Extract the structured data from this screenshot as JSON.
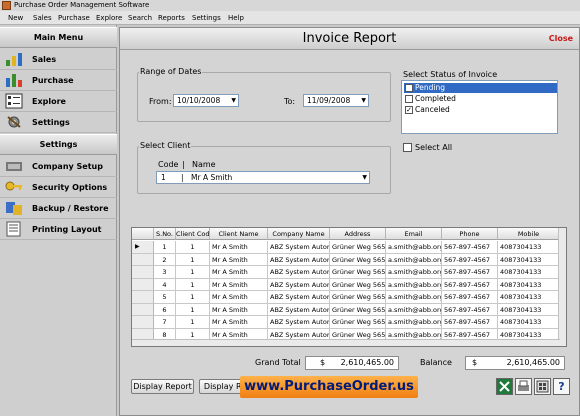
{
  "window": {
    "title": "Purchase Order Management Software"
  },
  "menubar": [
    "New",
    "Sales",
    "Purchase",
    "Explore",
    "Search",
    "Reports",
    "Settings",
    "Help"
  ],
  "sidebar": {
    "main_menu_title": "Main Menu",
    "main_items": [
      {
        "label": "Sales",
        "icon": "sales-chart-icon"
      },
      {
        "label": "Purchase",
        "icon": "purchase-chart-icon"
      },
      {
        "label": "Explore",
        "icon": "explore-list-icon"
      },
      {
        "label": "Settings",
        "icon": "settings-gear-icon"
      }
    ],
    "settings_title": "Settings",
    "settings_items": [
      {
        "label": "Company Setup",
        "icon": "company-setup-icon"
      },
      {
        "label": "Security Options",
        "icon": "security-key-icon"
      },
      {
        "label": "Backup / Restore",
        "icon": "backup-restore-icon"
      },
      {
        "label": "Printing Layout",
        "icon": "printing-layout-icon"
      }
    ]
  },
  "report": {
    "title": "Invoice Report",
    "close_label": "Close",
    "date_range": {
      "group_label": "Range of Dates",
      "from_label": "From:",
      "from_value": "10/10/2008",
      "to_label": "To:",
      "to_value": "11/09/2008"
    },
    "client": {
      "group_label": "Select Client",
      "code_header": "Code",
      "separator": "|",
      "name_header": "Name",
      "selected_code": "1",
      "selected_name": "Mr A Smith"
    },
    "status": {
      "group_label": "Select Status of Invoice",
      "options": [
        {
          "label": "Pending",
          "checked": "✓",
          "selected": true
        },
        {
          "label": "Completed",
          "checked": "",
          "selected": false
        },
        {
          "label": "Canceled",
          "checked": "✓",
          "selected": false
        }
      ],
      "select_all_label": "Select All"
    },
    "table": {
      "columns": [
        "S.No.",
        "Client Code",
        "Client Name",
        "Company Name",
        "Address",
        "Email",
        "Phone",
        "Mobile"
      ],
      "rows": [
        [
          "1",
          "1",
          "Mr A Smith",
          "ABZ System Autom...",
          "Grüner Weg 565...",
          "a.smith@abb.org",
          "567-897-4567",
          "4087304133"
        ],
        [
          "2",
          "1",
          "Mr A Smith",
          "ABZ System Autom...",
          "Grüner Weg 565...",
          "a.smith@abb.org",
          "567-897-4567",
          "4087304133"
        ],
        [
          "3",
          "1",
          "Mr A Smith",
          "ABZ System Autom...",
          "Grüner Weg 565...",
          "a.smith@abb.org",
          "567-897-4567",
          "4087304133"
        ],
        [
          "4",
          "1",
          "Mr A Smith",
          "ABZ System Autom...",
          "Grüner Weg 565...",
          "a.smith@abb.org",
          "567-897-4567",
          "4087304133"
        ],
        [
          "5",
          "1",
          "Mr A Smith",
          "ABZ System Autom...",
          "Grüner Weg 565...",
          "a.smith@abb.org",
          "567-897-4567",
          "4087304133"
        ],
        [
          "6",
          "1",
          "Mr A Smith",
          "ABZ System Autom...",
          "Grüner Weg 565...",
          "a.smith@abb.org",
          "567-897-4567",
          "4087304133"
        ],
        [
          "7",
          "1",
          "Mr A Smith",
          "ABZ System Autom...",
          "Grüner Weg 565...",
          "a.smith@abb.org",
          "567-897-4567",
          "4087304133"
        ],
        [
          "8",
          "1",
          "Mr A Smith",
          "ABZ System Autom...",
          "Grüner Weg 565...",
          "a.smith@abb.org",
          "567-897-4567",
          "4087304133"
        ]
      ],
      "current_row_marker": "▶"
    },
    "totals": {
      "grand_total_label": "Grand Total",
      "grand_total_currency": "$",
      "grand_total_value": "2,610,465.00",
      "balance_label": "Balance",
      "balance_currency": "$",
      "balance_value": "2,610,465.00"
    },
    "buttons": {
      "display_report": "Display Report",
      "display_report_2": "Display Re"
    },
    "banner_text": "www.PurchaseOrder.us",
    "toolbar_icons": [
      "excel-export-icon",
      "print-icon",
      "calculator-icon",
      "help-icon"
    ],
    "help_glyph": "?"
  }
}
